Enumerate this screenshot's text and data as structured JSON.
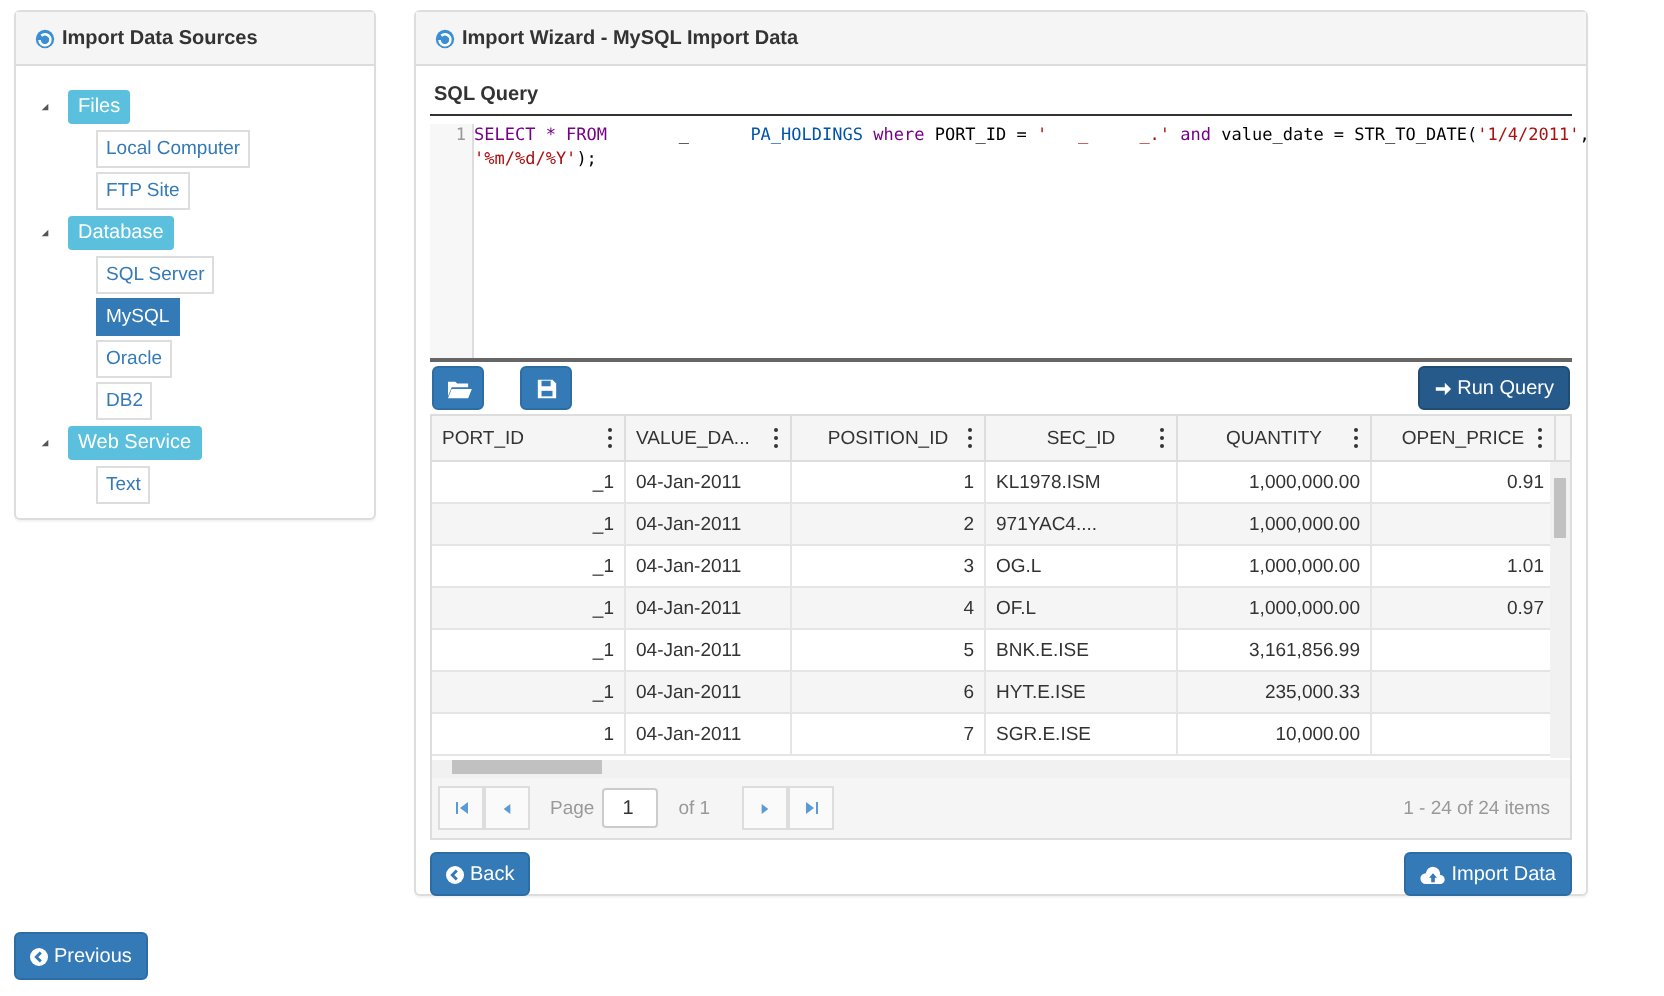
{
  "sources_panel": {
    "title": "Import Data Sources",
    "tree": [
      {
        "label": "Files",
        "selected": false,
        "children": [
          {
            "label": "Local Computer",
            "selected": false
          },
          {
            "label": "FTP Site",
            "selected": false
          }
        ]
      },
      {
        "label": "Database",
        "selected": false,
        "children": [
          {
            "label": "SQL Server",
            "selected": false
          },
          {
            "label": "MySQL",
            "selected": true
          },
          {
            "label": "Oracle",
            "selected": false
          },
          {
            "label": "DB2",
            "selected": false
          }
        ]
      },
      {
        "label": "Web Service",
        "selected": false,
        "children": [
          {
            "label": "Text",
            "selected": false
          }
        ]
      }
    ]
  },
  "wizard": {
    "title": "Import Wizard - MySQL Import Data",
    "query_label": "SQL Query",
    "code_lines": [
      {
        "number": "1",
        "tokens": [
          {
            "text": "SELECT * FROM ",
            "kind": "keyword"
          },
          {
            "text": "      _      ",
            "kind": "plain"
          },
          {
            "text": "PA_HOLDINGS ",
            "kind": "ident"
          },
          {
            "text": "where ",
            "kind": "keyword"
          },
          {
            "text": "PORT_ID = ",
            "kind": "plain"
          },
          {
            "text": "'   _     _.'",
            "kind": "string"
          },
          {
            "text": " and ",
            "kind": "keyword"
          },
          {
            "text": "value_date = STR_TO_DATE(",
            "kind": "plain"
          },
          {
            "text": "'1/4/2011'",
            "kind": "string"
          },
          {
            "text": ",",
            "kind": "plain"
          }
        ]
      },
      {
        "tokens": [
          {
            "text": "'%m/%d/%Y'",
            "kind": "string"
          },
          {
            "text": ");",
            "kind": "plain"
          }
        ]
      }
    ],
    "run_button": "Run Query",
    "grid": {
      "columns": [
        {
          "label": "PORT_ID"
        },
        {
          "label": "VALUE_DA..."
        },
        {
          "label": "POSITION_ID"
        },
        {
          "label": "SEC_ID"
        },
        {
          "label": "QUANTITY"
        },
        {
          "label": "OPEN_PRICE"
        }
      ],
      "rows": [
        [
          "_1",
          "04-Jan-2011",
          "1",
          "KL1978.ISM",
          "1,000,000.00",
          "0.91"
        ],
        [
          "_1",
          "04-Jan-2011",
          "2",
          "971YAC4....",
          "1,000,000.00",
          ""
        ],
        [
          "_1",
          "04-Jan-2011",
          "3",
          "OG.L",
          "1,000,000.00",
          "1.01"
        ],
        [
          "_1",
          "04-Jan-2011",
          "4",
          "OF.L",
          "1,000,000.00",
          "0.97"
        ],
        [
          "_1",
          "04-Jan-2011",
          "5",
          "BNK.E.ISE",
          "3,161,856.99",
          ""
        ],
        [
          "_1",
          "04-Jan-2011",
          "6",
          "HYT.E.ISE",
          "235,000.33",
          ""
        ],
        [
          "1",
          "04-Jan-2011",
          "7",
          "SGR.E.ISE",
          "10,000.00",
          ""
        ]
      ]
    },
    "pager": {
      "page_label": "Page",
      "page": "1",
      "of_label": "of 1",
      "summary": "1 - 24 of 24 items"
    },
    "back_button": "Back",
    "import_button": "Import Data"
  },
  "previous_button": "Previous"
}
